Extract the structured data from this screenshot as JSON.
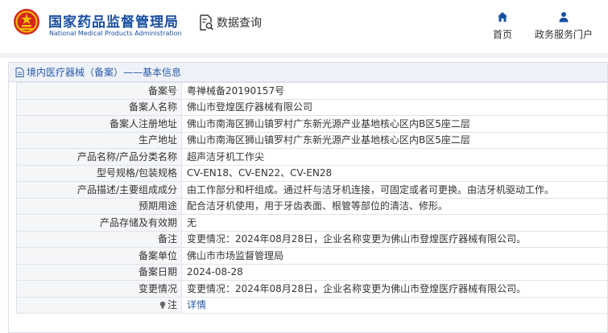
{
  "header": {
    "brand_cn": "国家药品监督管理局",
    "brand_en": "National Medical Products Administration",
    "search_tab": "数据查询",
    "nav": [
      {
        "label": "首页",
        "icon": "home-icon"
      },
      {
        "label": "政务服务门户",
        "icon": "user-icon"
      }
    ]
  },
  "breadcrumb": "境内医疗器械（备案）——基本信息",
  "fields": [
    {
      "label": "备案号",
      "value": "粤禅械备20190157号"
    },
    {
      "label": "备案人名称",
      "value": "佛山市登煌医疗器械有限公司"
    },
    {
      "label": "备案人注册地址",
      "value": "佛山市南海区狮山镇罗村广东新光源产业基地核心区内B区5座二层"
    },
    {
      "label": "生产地址",
      "value": "佛山市南海区狮山镇罗村广东新光源产业基地核心区内B区5座二层"
    },
    {
      "label": "产品名称/产品分类名称",
      "value": "超声洁牙机工作尖"
    },
    {
      "label": "型号规格/包装规格",
      "value": "CV-EN18、CV-EN22、CV-EN28"
    },
    {
      "label": "产品描述/主要组成成分",
      "value": "由工作部分和杆组成。通过杆与洁牙机连接，可固定或者可更换。由洁牙机驱动工作。"
    },
    {
      "label": "预期用途",
      "value": "配合洁牙机使用，用于牙齿表面、根管等部位的清洁、修形。"
    },
    {
      "label": "产品存储及有效期",
      "value": "无"
    },
    {
      "label": "备注",
      "value": "变更情况：2024年08月28日，企业名称变更为佛山市登煌医疗器械有限公司。"
    },
    {
      "label": "备案单位",
      "value": "佛山市市场监督管理局"
    },
    {
      "label": "备案日期",
      "value": "2024-08-28"
    },
    {
      "label": "变更情况",
      "value": "变更情况：2024年08月28日，企业名称变更为佛山市登煌医疗器械有限公司。"
    }
  ],
  "remark": {
    "label": "注",
    "link": "详情",
    "icon": "bulb-icon"
  },
  "colors": {
    "brand": "#1a4fa0",
    "link": "#2b5aa6",
    "logo_red": "#d7261f",
    "logo_gold": "#f2c200"
  }
}
